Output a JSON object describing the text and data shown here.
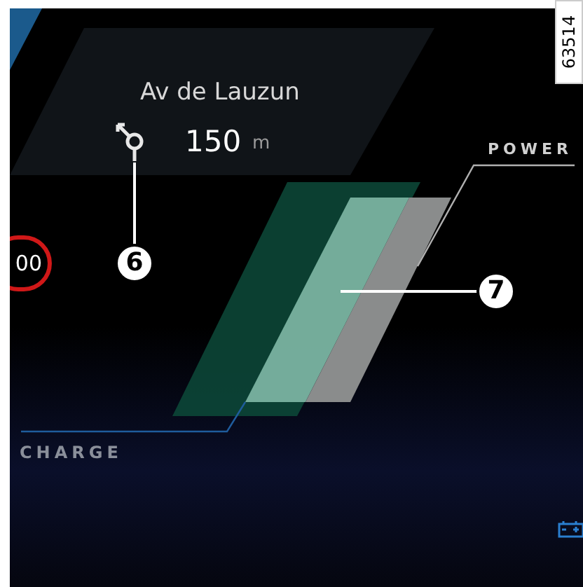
{
  "figure_code": "63514",
  "navigation": {
    "street": "Av de Lauzun",
    "distance": "150",
    "unit": "m"
  },
  "speed_limit": {
    "value": "00"
  },
  "power_meter": {
    "top_label": "POWER",
    "bottom_label": "CHARGE"
  },
  "callouts": [
    {
      "number": "6"
    },
    {
      "number": "7"
    }
  ]
}
